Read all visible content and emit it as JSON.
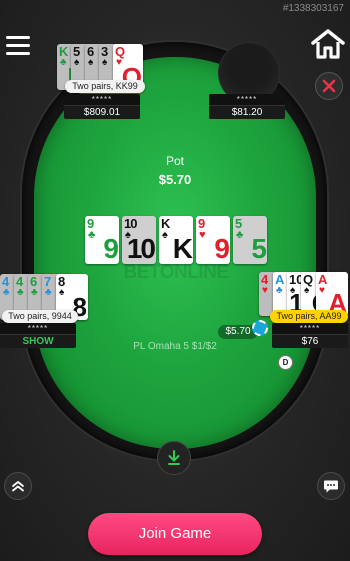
{
  "hand_id": "#1338303167",
  "table": {
    "watermark": "BETONLINE",
    "game_info": "PL Omaha 5 $1/$2",
    "pot_label": "Pot",
    "pot_value": "$5.70"
  },
  "board": [
    {
      "rank": "9",
      "suit": "♣",
      "color": "green",
      "dim": false
    },
    {
      "rank": "10",
      "suit": "♠",
      "color": "black",
      "dim": true
    },
    {
      "rank": "K",
      "suit": "♠",
      "color": "black",
      "dim": false
    },
    {
      "rank": "9",
      "suit": "♥",
      "color": "red",
      "dim": false
    },
    {
      "rank": "5",
      "suit": "♣",
      "color": "green",
      "dim": true
    }
  ],
  "players": {
    "top_left": {
      "cards": [
        {
          "rank": "K",
          "suit": "♣",
          "color": "green"
        },
        {
          "rank": "5",
          "suit": "♠",
          "color": "black"
        },
        {
          "rank": "6",
          "suit": "♠",
          "color": "black"
        },
        {
          "rank": "3",
          "suit": "♠",
          "color": "black"
        },
        {
          "rank": "Q",
          "suit": "♥",
          "color": "red"
        }
      ],
      "hand": "Two pairs, KK99",
      "name": "*****",
      "stack": "$809.01"
    },
    "top_right": {
      "name": "*****",
      "stack": "$81.20"
    },
    "left": {
      "cards": [
        {
          "rank": "4",
          "suit": "♣",
          "color": "blue"
        },
        {
          "rank": "4",
          "suit": "♣",
          "color": "green"
        },
        {
          "rank": "6",
          "suit": "♣",
          "color": "green"
        },
        {
          "rank": "7",
          "suit": "♣",
          "color": "blue"
        },
        {
          "rank": "8",
          "suit": "♠",
          "color": "black"
        }
      ],
      "hand": "Two pairs, 9944",
      "name": "*****",
      "stack": "SHOW"
    },
    "right": {
      "cards": [
        {
          "rank": "4",
          "suit": "♥",
          "color": "red"
        },
        {
          "rank": "A",
          "suit": "♣",
          "color": "blue"
        },
        {
          "rank": "10",
          "suit": "♠",
          "color": "black"
        },
        {
          "rank": "Q",
          "suit": "♠",
          "color": "black"
        },
        {
          "rank": "A",
          "suit": "♥",
          "color": "red"
        }
      ],
      "hand": "Two pairs, AA99",
      "name": "*****",
      "stack": "$76",
      "bet": "$5.70",
      "dealer": "D"
    }
  },
  "controls": {
    "join_label": "Join Game"
  },
  "colors": {
    "felt": "#1ea43e",
    "join_button": "#f0306b",
    "winner_label": "#ffd200",
    "show_text": "#35c759"
  },
  "icons": [
    "menu-icon",
    "home-icon",
    "close-icon",
    "arrow-down-icon",
    "chevron-up-icon",
    "chat-icon"
  ]
}
